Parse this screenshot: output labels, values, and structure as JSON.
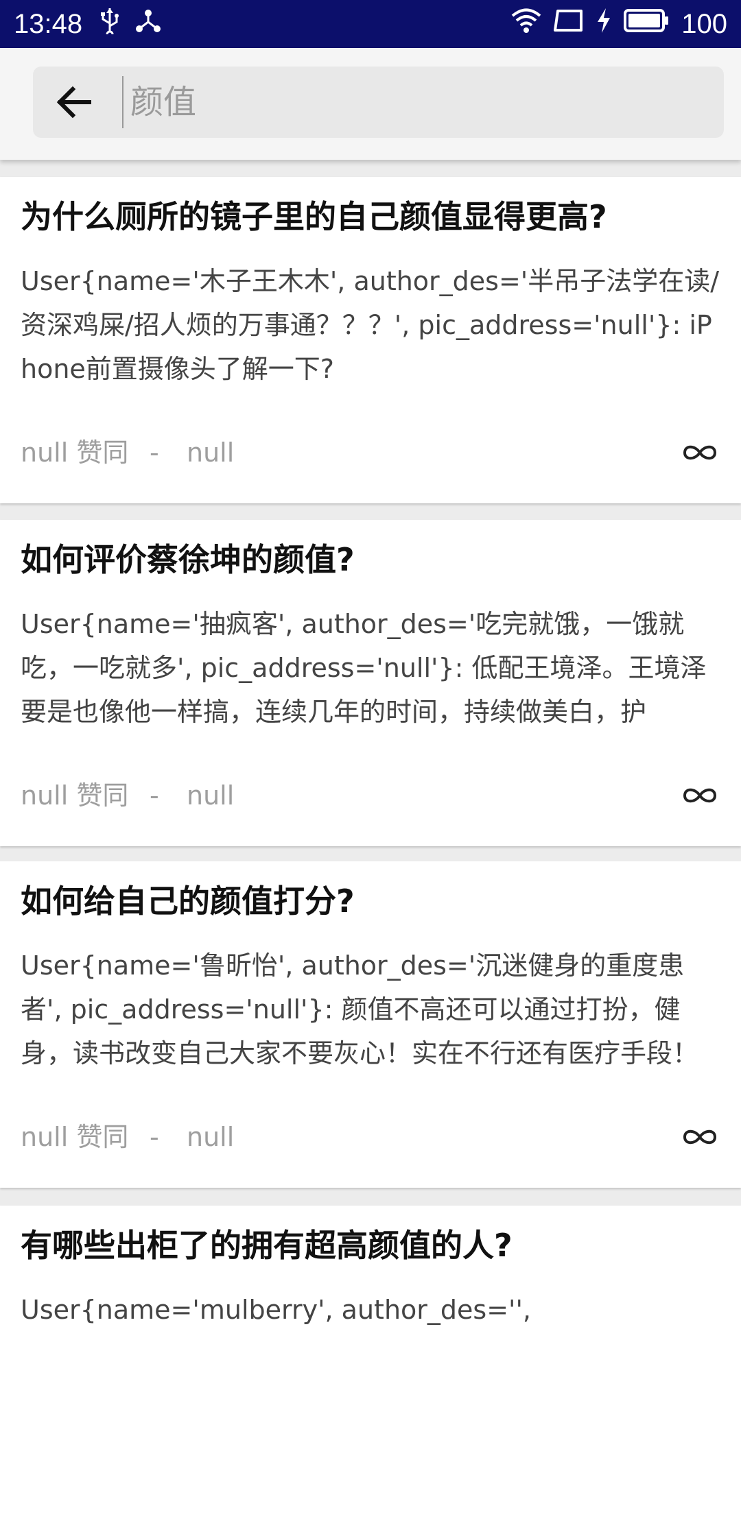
{
  "status_bar": {
    "time": "13:48",
    "battery": "100",
    "icons": [
      "usb-icon",
      "share-icon",
      "wifi-icon",
      "screen-rotation-icon",
      "charging-icon",
      "battery-icon"
    ]
  },
  "search": {
    "value": "",
    "placeholder": "颜值",
    "back_icon": "back-arrow-icon"
  },
  "feed": {
    "items": [
      {
        "title": "为什么厕所的镜子里的自己颜值显得更高?",
        "body": "User{name='木子王木木', author_des='半吊子法学在读/资深鸡屎/招人烦的万事通？？？', pic_address='null'}: iPhone前置摄像头了解一下?",
        "votes": "null 赞同",
        "separator": "-",
        "time": "null"
      },
      {
        "title": "如何评价蔡徐坤的颜值?",
        "body": "User{name='抽疯客', author_des='吃完就饿，一饿就吃，一吃就多', pic_address='null'}: 低配王境泽。王境泽要是也像他一样搞，连续几年的时间，持续做美白，护",
        "votes": "null 赞同",
        "separator": "-",
        "time": "null"
      },
      {
        "title": "如何给自己的颜值打分?",
        "body": "User{name='鲁昕怡', author_des='沉迷健身的重度患者', pic_address='null'}: 颜值不高还可以通过打扮，健身，读书改变自己大家不要灰心！实在不行还有医疗手段！",
        "votes": "null 赞同",
        "separator": "-",
        "time": "null"
      },
      {
        "title": "有哪些出柜了的拥有超高颜值的人?",
        "body": "User{name='mulberry', author_des='',",
        "votes": "",
        "separator": "",
        "time": ""
      }
    ]
  },
  "colors": {
    "status_bar": "#0c0f6b",
    "header": "#f5f5f5",
    "search_box": "#e8e8e8",
    "card": "#ffffff",
    "background": "#ececec",
    "title_text": "#111111",
    "body_text": "#444444",
    "meta_text": "#9e9e9e"
  }
}
